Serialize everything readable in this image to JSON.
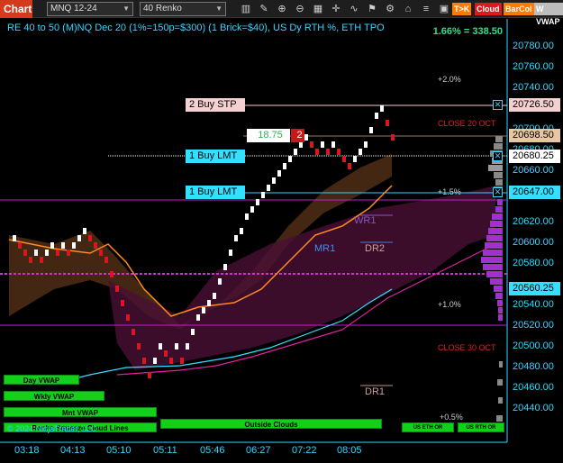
{
  "toolbar": {
    "chart_tab": "Chart",
    "instrument": "MNQ 12-24",
    "bar_type": "40 Renko",
    "badges": [
      {
        "label": "T>K",
        "color": "#ff7a00"
      },
      {
        "label": "Cloud",
        "color": "#e0171e"
      },
      {
        "label": "BarCol",
        "color": "#ff7a00"
      },
      {
        "label": "W VWAP",
        "color": "#bdbdbd"
      }
    ]
  },
  "chart": {
    "header": "RE 40 to 50 (M)NQ Dec 20 (1%=150p=$300) (1 Brick=$40), US Dy RTH %, ETH TPO",
    "percent_change": "1.66% = 338.50",
    "y_axis": [
      "20780.00",
      "20760.00",
      "20740.00",
      "20720.00",
      "20700.00",
      "20680.00",
      "20660.00",
      "20640.00",
      "20620.00",
      "20600.00",
      "20580.00",
      "20560.00",
      "20540.00",
      "20520.00",
      "20500.00",
      "20480.00",
      "20460.00",
      "20440.00"
    ],
    "x_axis": [
      "03:18",
      "04:13",
      "05:10",
      "05:11",
      "05:46",
      "06:27",
      "07:22",
      "08:05"
    ],
    "price_boxes": [
      {
        "value": "20726.50",
        "bg": "#f5d0d0",
        "fg": "#000"
      },
      {
        "value": "20698.50",
        "bg": "#e8c7a0",
        "fg": "#000"
      },
      {
        "value": "20680.25",
        "bg": "#ffffff",
        "fg": "#000"
      },
      {
        "value": "20647.00",
        "bg": "#33e0ff",
        "fg": "#000"
      },
      {
        "value": "20560.25",
        "bg": "#33e0ff",
        "fg": "#000"
      }
    ],
    "orders": {
      "stop": "2 Buy STP",
      "limit1": "1 Buy LMT",
      "limit2": "1 Buy LMT",
      "position_pnl": "18.75",
      "position_qty": "2"
    },
    "levels": {
      "p2": "+2.0%",
      "p15": "+1.5%",
      "p1": "+1.0%",
      "p05": "+0.5%",
      "close20": "CLOSE 20 OCT",
      "close30": "CLOSE 30 OCT",
      "wr1": "WR1",
      "mr1": "MR1",
      "dr2": "DR2",
      "dr1": "DR1"
    },
    "buttons": {
      "day_vwap": "Day VWAP",
      "wkly_vwap": "Wkly VWAP",
      "mnt_vwap": "Mnt VWAP",
      "renko_cloud": "Renko Squeeze Cloud Lines",
      "outside_clouds": "Outside Clouds",
      "us_eth_or": "US ETH OR",
      "us_rth_or": "US RTH OR"
    },
    "copyright": "© 2024 NinjaTrader, LLC"
  },
  "colors": {
    "axis_text": "#33d6ff",
    "up_brick": "#ffffff",
    "down_brick": "#e0141e",
    "accent_green": "#13d11b",
    "magenta_level": "#c020c0"
  }
}
